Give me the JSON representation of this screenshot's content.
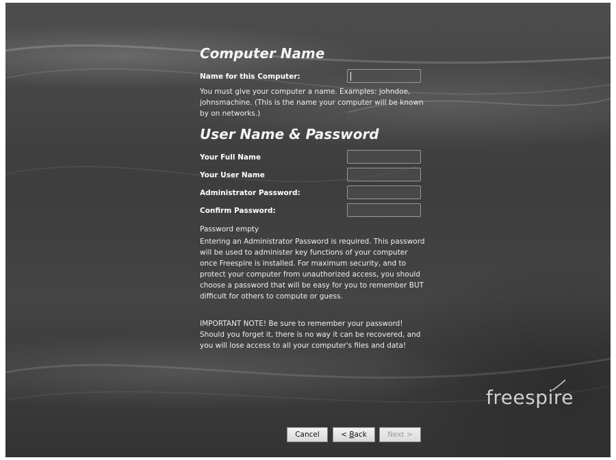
{
  "computer_name": {
    "heading": "Computer Name",
    "field_label": "Name for this Computer:",
    "help_text": "You must give your computer a name.  Examples: johndoe, johnsmachine. (This is the name your computer will be known by on networks.)"
  },
  "user_section": {
    "heading": "User Name & Password",
    "full_name_label": "Your Full Name",
    "user_name_label": "Your User Name",
    "admin_password_label": "Administrator Password:",
    "confirm_password_label": "Confirm Password:",
    "password_status": "Password empty",
    "password_help": "Entering an Administrator Password is required.  This password will be used to administer key functions of your computer once Freespire is installed.  For maximum security, and to protect your computer from unauthorized access, you should choose a password that will be easy for you to remember BUT difficult for others to compute or guess.",
    "important_note": "IMPORTANT NOTE!  Be sure to remember your password! Should you forget it, there is no way it can be recovered, and you will lose access to all your computer's files and data!"
  },
  "fields": {
    "computer_name_value": "",
    "full_name_value": "",
    "user_name_value": "",
    "admin_password_value": "",
    "confirm_password_value": ""
  },
  "brand": {
    "logo_text": "freespire"
  },
  "buttons": {
    "cancel": "Cancel",
    "back_prefix": "< ",
    "back_mnemonic": "B",
    "back_rest": "ack",
    "next": "Next >",
    "next_enabled": false
  }
}
